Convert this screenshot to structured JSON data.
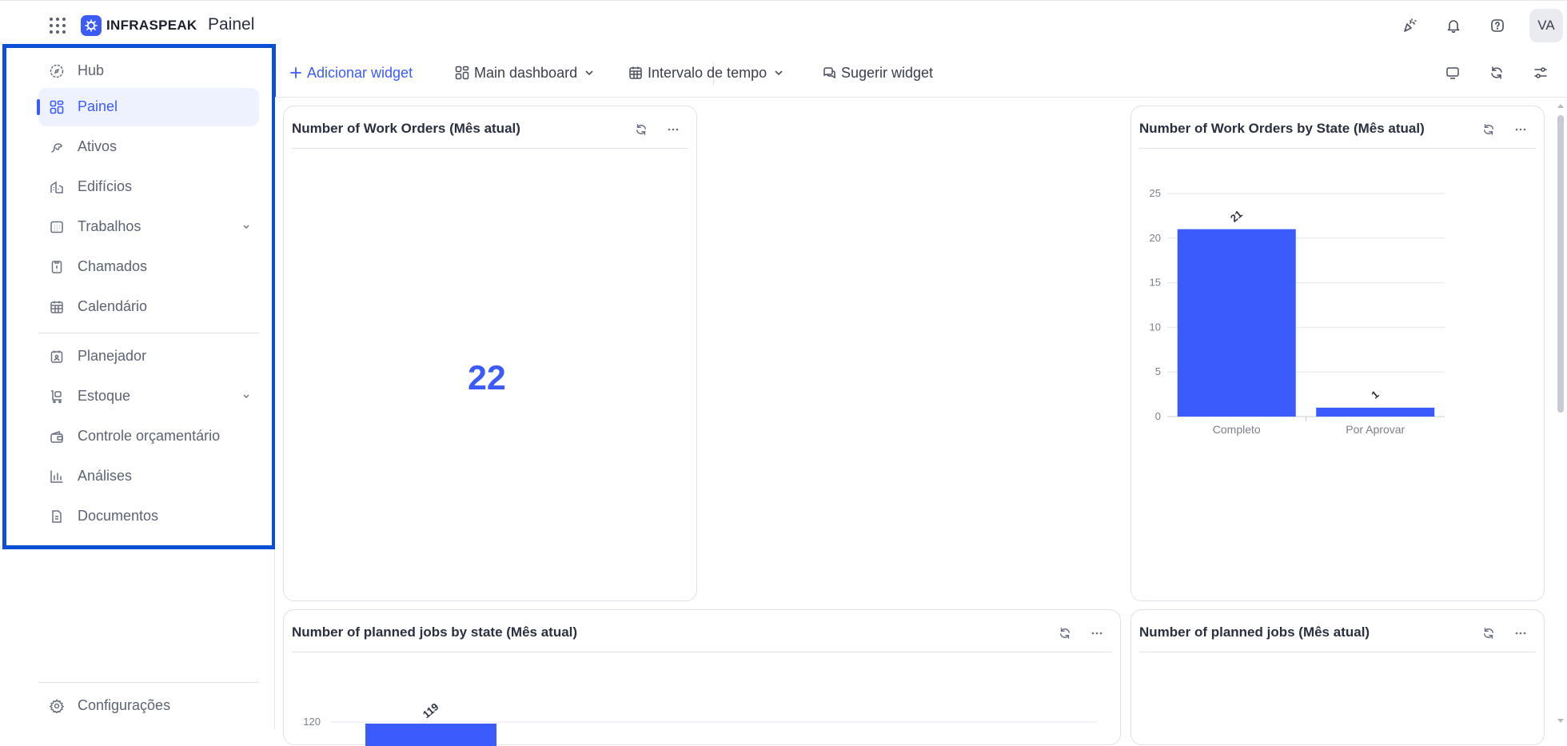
{
  "app": {
    "brand": "INFRASPEAK",
    "page_title": "Painel",
    "avatar_initials": "VA"
  },
  "sidebar": {
    "items": [
      {
        "label": "Hub",
        "icon": "compass-icon"
      },
      {
        "label": "Painel",
        "icon": "dashboard-icon",
        "active": true
      },
      {
        "label": "Ativos",
        "icon": "wrench-icon"
      },
      {
        "label": "Edifícios",
        "icon": "building-icon"
      },
      {
        "label": "Trabalhos",
        "icon": "calendar-grid-icon",
        "expandable": true
      },
      {
        "label": "Chamados",
        "icon": "clipboard-icon"
      },
      {
        "label": "Calendário",
        "icon": "calendar-icon"
      },
      {
        "label": "Planejador",
        "icon": "planner-icon"
      },
      {
        "label": "Estoque",
        "icon": "cart-icon",
        "expandable": true
      },
      {
        "label": "Controle orçamentário",
        "icon": "wallet-icon"
      },
      {
        "label": "Análises",
        "icon": "bar-chart-icon"
      },
      {
        "label": "Documentos",
        "icon": "document-icon"
      }
    ],
    "settings_label": "Configurações"
  },
  "toolbar": {
    "add_widget": "Adicionar widget",
    "dashboard_select": "Main dashboard",
    "time_range": "Intervalo de tempo",
    "suggest_widget": "Sugerir widget"
  },
  "widgets": {
    "work_orders": {
      "title": "Number of Work Orders (Mês atual)",
      "value": "22"
    },
    "work_orders_by_state": {
      "title": "Number of Work Orders by State (Mês atual)"
    },
    "planned_jobs_by_state": {
      "title": "Number of planned jobs by state (Mês atual)"
    },
    "planned_jobs": {
      "title": "Number of planned jobs (Mês atual)"
    }
  },
  "chart_data": [
    {
      "type": "bar",
      "categories": [
        "Completo",
        "Por Aprovar"
      ],
      "values": [
        21,
        1
      ],
      "ylim": [
        0,
        25
      ],
      "yticks": [
        "0",
        "5",
        "10",
        "15",
        "20",
        "25"
      ],
      "data_labels": [
        "21",
        "1"
      ],
      "grid": true,
      "color": "#3b5bfd"
    },
    {
      "type": "bar",
      "values": [
        119
      ],
      "data_labels": [
        "119"
      ],
      "yticks": [
        "120"
      ],
      "color": "#3b5bfd"
    }
  ]
}
